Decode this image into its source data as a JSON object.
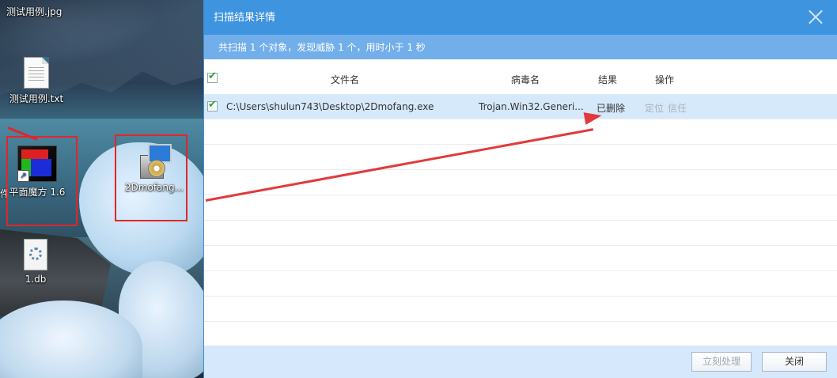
{
  "desktop": {
    "top_label": "测试用例.jpg",
    "icons": [
      {
        "label": "测试用例.txt"
      },
      {
        "label": "平面魔方 1.6"
      },
      {
        "label": "2Dmofang..."
      },
      {
        "label": "1.db"
      }
    ],
    "edge_glyph": "件"
  },
  "dialog": {
    "title": "扫描结果详情",
    "summary": "共扫描 1 个对象，发现威胁 1 个，用时小于 1 秒",
    "columns": {
      "file": "文件名",
      "virus": "病毒名",
      "result": "结果",
      "action": "操作"
    },
    "rows": [
      {
        "checked": true,
        "path": "C:\\Users\\shulun743\\Desktop\\2Dmofang.exe",
        "virus": "Trojan.Win32.Generi...",
        "result": "已删除",
        "action_locate": "定位",
        "action_trust": "信任"
      }
    ],
    "buttons": {
      "process_now": "立刻处理",
      "close": "关闭"
    }
  },
  "colors": {
    "titlebar": "#3f94e0",
    "summary_bar": "#72aeea",
    "selected_row": "#d6e9fb",
    "annotation_red": "#e0262a"
  }
}
